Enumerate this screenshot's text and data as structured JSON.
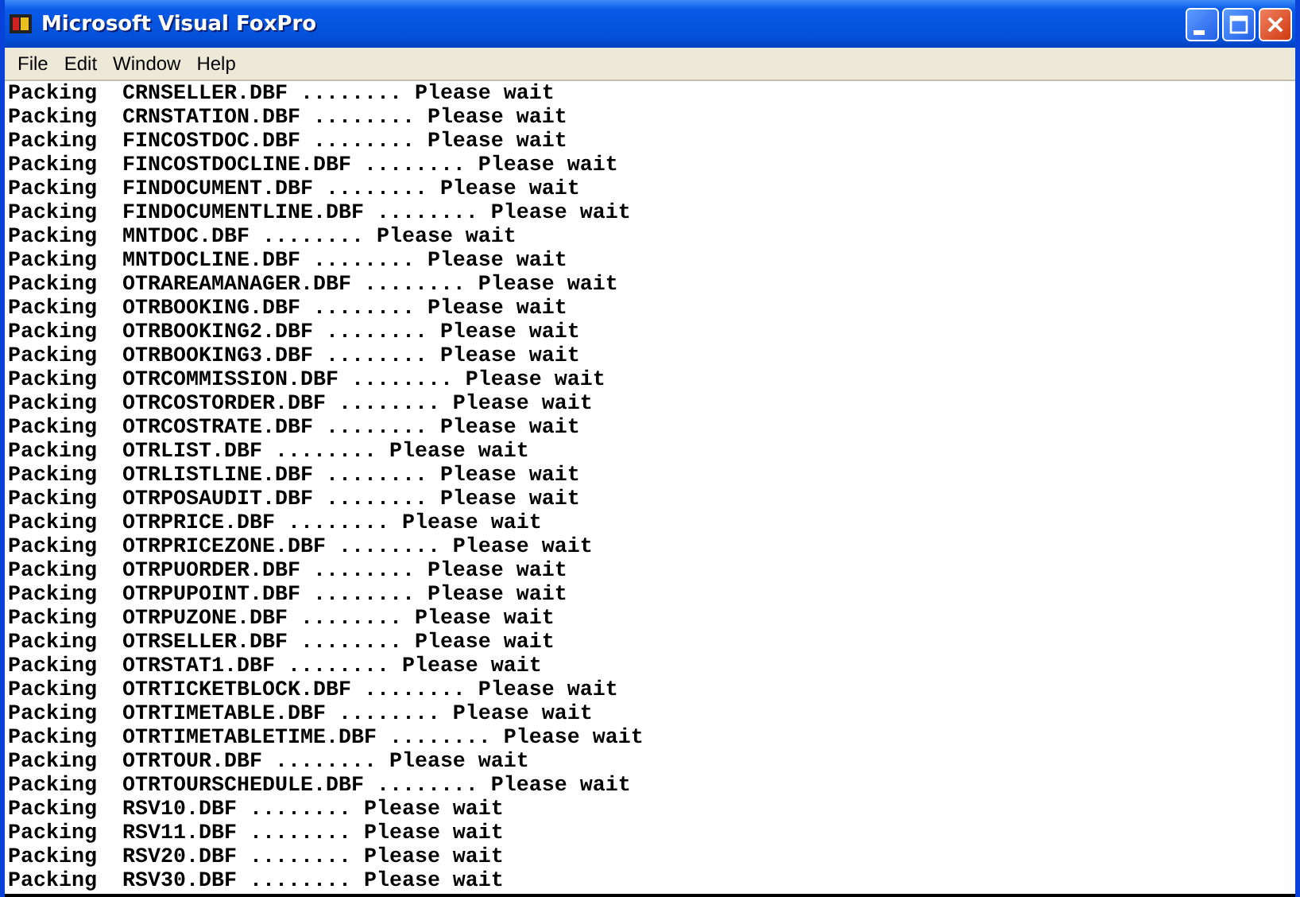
{
  "window": {
    "title": "Microsoft Visual FoxPro"
  },
  "menu": [
    "File",
    "Edit",
    "Window",
    "Help"
  ],
  "output_lines": [
    "Packing  CRNSELLER.DBF ........ Please wait",
    "Packing  CRNSTATION.DBF ........ Please wait",
    "Packing  FINCOSTDOC.DBF ........ Please wait",
    "Packing  FINCOSTDOCLINE.DBF ........ Please wait",
    "Packing  FINDOCUMENT.DBF ........ Please wait",
    "Packing  FINDOCUMENTLINE.DBF ........ Please wait",
    "Packing  MNTDOC.DBF ........ Please wait",
    "Packing  MNTDOCLINE.DBF ........ Please wait",
    "Packing  OTRAREAMANAGER.DBF ........ Please wait",
    "Packing  OTRBOOKING.DBF ........ Please wait",
    "Packing  OTRBOOKING2.DBF ........ Please wait",
    "Packing  OTRBOOKING3.DBF ........ Please wait",
    "Packing  OTRCOMMISSION.DBF ........ Please wait",
    "Packing  OTRCOSTORDER.DBF ........ Please wait",
    "Packing  OTRCOSTRATE.DBF ........ Please wait",
    "Packing  OTRLIST.DBF ........ Please wait",
    "Packing  OTRLISTLINE.DBF ........ Please wait",
    "Packing  OTRPOSAUDIT.DBF ........ Please wait",
    "Packing  OTRPRICE.DBF ........ Please wait",
    "Packing  OTRPRICEZONE.DBF ........ Please wait",
    "Packing  OTRPUORDER.DBF ........ Please wait",
    "Packing  OTRPUPOINT.DBF ........ Please wait",
    "Packing  OTRPUZONE.DBF ........ Please wait",
    "Packing  OTRSELLER.DBF ........ Please wait",
    "Packing  OTRSTAT1.DBF ........ Please wait",
    "Packing  OTRTICKETBLOCK.DBF ........ Please wait",
    "Packing  OTRTIMETABLE.DBF ........ Please wait",
    "Packing  OTRTIMETABLETIME.DBF ........ Please wait",
    "Packing  OTRTOUR.DBF ........ Please wait",
    "Packing  OTRTOURSCHEDULE.DBF ........ Please wait",
    "Packing  RSV10.DBF ........ Please wait",
    "Packing  RSV11.DBF ........ Please wait",
    "Packing  RSV20.DBF ........ Please wait",
    "Packing  RSV30.DBF ........ Please wait"
  ]
}
